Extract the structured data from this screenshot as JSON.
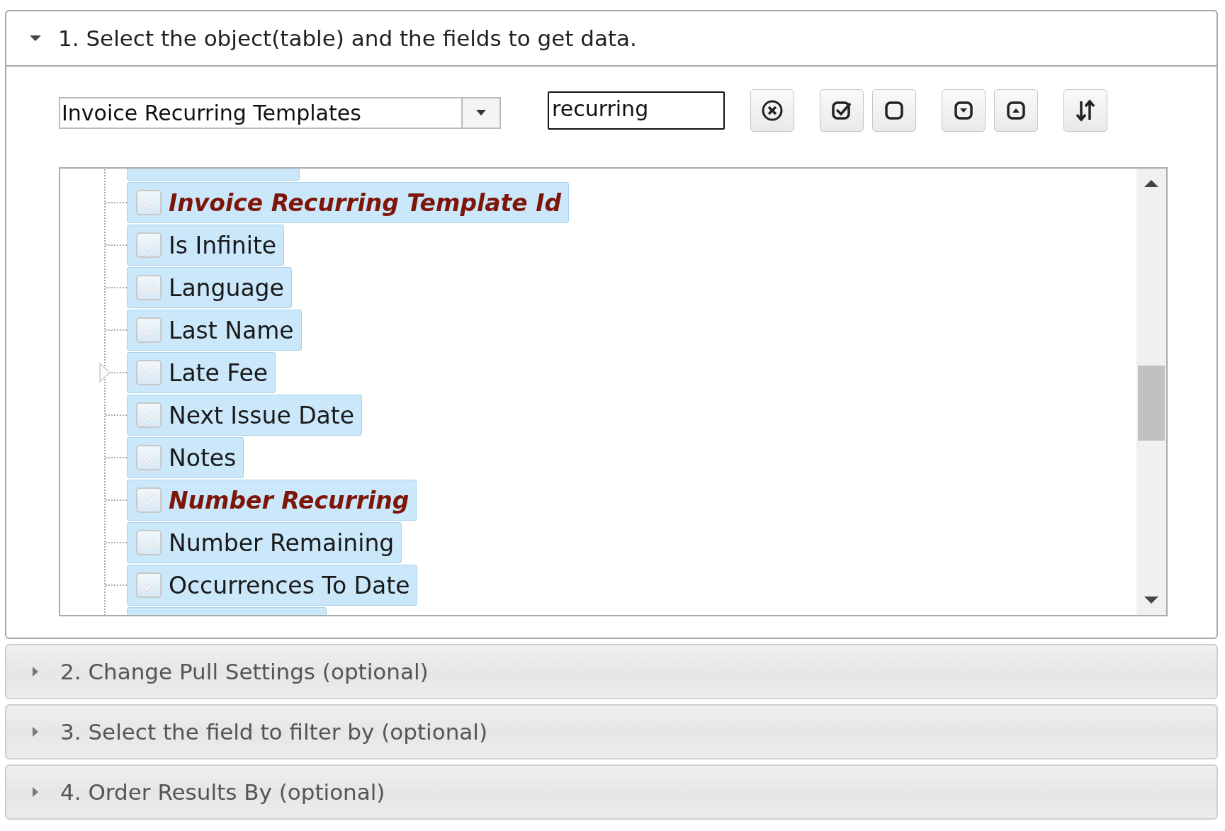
{
  "sections": [
    {
      "title": "1. Select the object(table) and the fields to get data.",
      "expanded": true
    },
    {
      "title": "2. Change Pull Settings (optional)",
      "expanded": false
    },
    {
      "title": "3. Select the field to filter by (optional)",
      "expanded": false
    },
    {
      "title": "4. Order Results By (optional)",
      "expanded": false
    }
  ],
  "object_select": {
    "value": "Invoice Recurring Templates"
  },
  "search": {
    "value": "recurring"
  },
  "toolbar_buttons": [
    {
      "kind": "clear"
    },
    {
      "kind": "check_all"
    },
    {
      "kind": "uncheck_all"
    },
    {
      "kind": "expand_all"
    },
    {
      "kind": "collapse_all"
    },
    {
      "kind": "sort"
    }
  ],
  "fields": [
    {
      "label": "Invoice Recurring Template Id",
      "checked": true,
      "highlighted": true,
      "has_children": false
    },
    {
      "label": "Is Infinite",
      "checked": true,
      "highlighted": false,
      "has_children": false
    },
    {
      "label": "Language",
      "checked": true,
      "highlighted": false,
      "has_children": false
    },
    {
      "label": "Last Name",
      "checked": true,
      "highlighted": false,
      "has_children": false
    },
    {
      "label": "Late Fee",
      "checked": true,
      "highlighted": false,
      "has_children": true
    },
    {
      "label": "Next Issue Date",
      "checked": true,
      "highlighted": false,
      "has_children": false
    },
    {
      "label": "Notes",
      "checked": true,
      "highlighted": false,
      "has_children": false
    },
    {
      "label": "Number Recurring",
      "checked": true,
      "highlighted": true,
      "has_children": false
    },
    {
      "label": "Number Remaining",
      "checked": true,
      "highlighted": false,
      "has_children": false
    },
    {
      "label": "Occurrences To Date",
      "checked": true,
      "highlighted": false,
      "has_children": false
    }
  ]
}
